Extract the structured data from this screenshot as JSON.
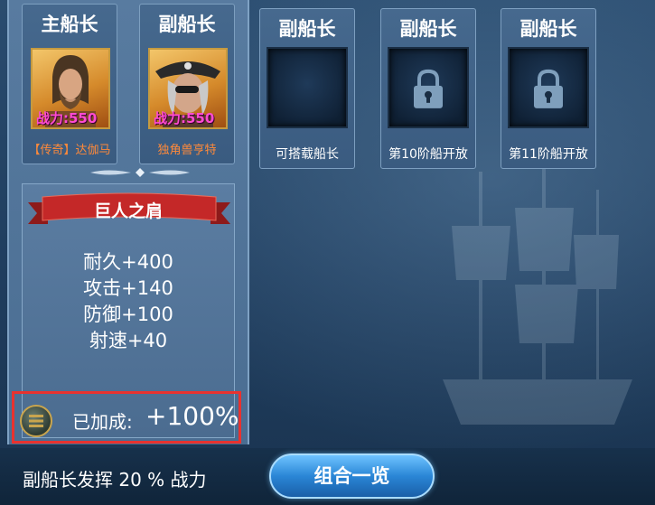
{
  "slots": [
    {
      "title": "主船长",
      "power": "战力:550",
      "name": "【传奇】达伽马",
      "type": "captain"
    },
    {
      "title": "副船长",
      "power": "战力:550",
      "name": "独角兽亨特",
      "type": "captain"
    },
    {
      "title": "副船长",
      "caption": "可搭载船长",
      "type": "empty"
    },
    {
      "title": "副船长",
      "caption": "第10阶船开放",
      "type": "locked"
    },
    {
      "title": "副船长",
      "caption": "第11阶船开放",
      "type": "locked"
    }
  ],
  "skill": {
    "name": "巨人之肩",
    "stats": [
      "耐久+400",
      "攻击+140",
      "防御+100",
      "射速+40"
    ],
    "bonus_label": "已加成:",
    "bonus_value": "+100%"
  },
  "footer": {
    "text": "副船长发挥 20 % 战力",
    "combo_button": "组合一览"
  },
  "colors": {
    "power": "#ff4bd2",
    "name": "#ff8a3a",
    "highlight": "#e8322f",
    "button": "#2a86d6"
  }
}
